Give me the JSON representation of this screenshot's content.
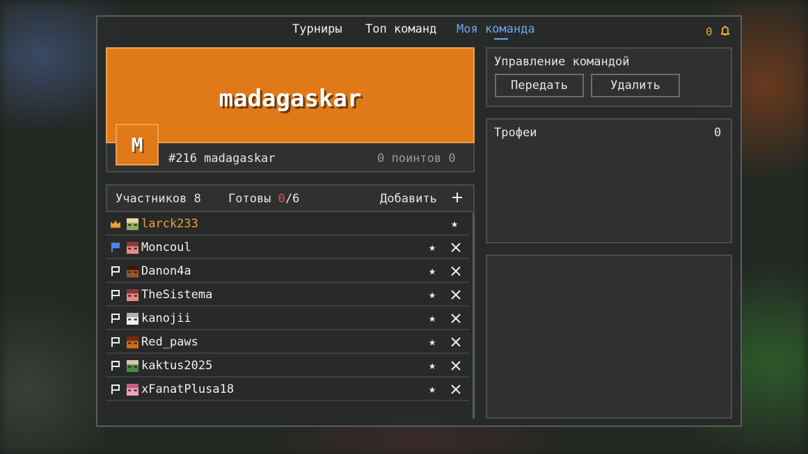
{
  "nav": {
    "tabs": [
      {
        "label": "Турниры"
      },
      {
        "label": "Топ команд"
      },
      {
        "label": "Моя команда"
      }
    ],
    "notifications": "0"
  },
  "team": {
    "name": "madagaskar",
    "avatar_letter": "M",
    "rank_line": "#216 madagaskar",
    "points_line": "0 поинтов 0",
    "banner_color": "#e07a18"
  },
  "members": {
    "count_label": "Участников 8",
    "ready_label": "Готовы",
    "ready_count": "0",
    "ready_total": "/6",
    "add_label": "Добавить",
    "rows": [
      {
        "name": "larck233",
        "role": "crown-icon",
        "skin": [
          "#8fae5a",
          "#e8d9b0"
        ]
      },
      {
        "name": "Moncoul",
        "role": "flag-icon",
        "skin": [
          "#e88a8a",
          "#8a3a3a"
        ]
      },
      {
        "name": "Danon4a",
        "role": "flag-outline-icon",
        "skin": [
          "#a0522d",
          "#3a1a0a"
        ]
      },
      {
        "name": "TheSistema",
        "role": "flag-outline-icon",
        "skin": [
          "#e88a8a",
          "#8a3a3a"
        ]
      },
      {
        "name": "kanojii",
        "role": "flag-outline-icon",
        "skin": [
          "#f0f0f0",
          "#b0b0b0"
        ]
      },
      {
        "name": "Red_paws",
        "role": "flag-outline-icon",
        "skin": [
          "#d2691e",
          "#7a2a0a"
        ]
      },
      {
        "name": "kaktus2025",
        "role": "flag-outline-icon",
        "skin": [
          "#4a8a4a",
          "#d9c9a0"
        ]
      },
      {
        "name": "xFanatPlusa18",
        "role": "flag-outline-icon",
        "skin": [
          "#f0a0c0",
          "#c06080"
        ]
      }
    ]
  },
  "management": {
    "title": "Управление командой",
    "transfer_label": "Передать",
    "delete_label": "Удалить"
  },
  "trophies": {
    "title": "Трофеи",
    "count": "0"
  }
}
